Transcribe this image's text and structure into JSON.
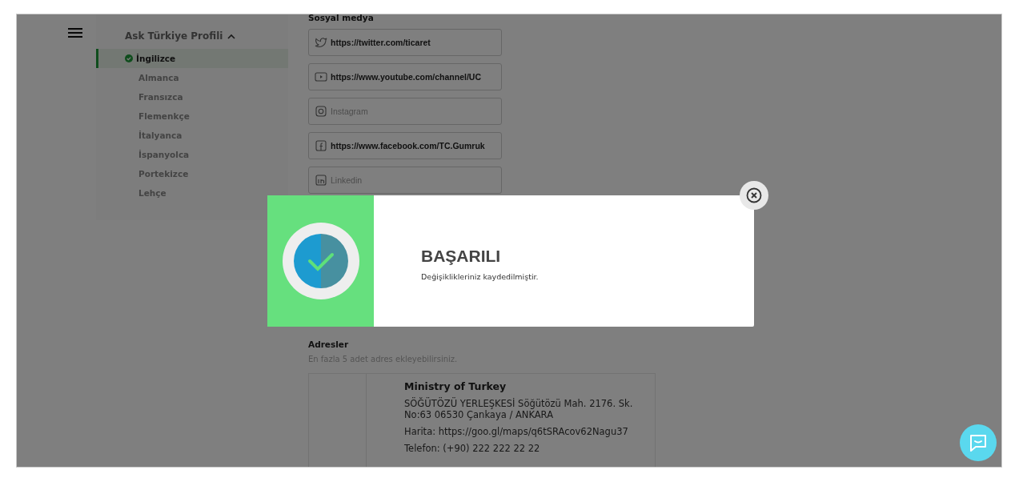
{
  "sidebar": {
    "title": "Ask Türkiye Profili",
    "expanded": true,
    "items": [
      {
        "label": "İngilizce",
        "selected": true,
        "done": true
      },
      {
        "label": "Almanca",
        "selected": false,
        "done": false
      },
      {
        "label": "Fransızca",
        "selected": false,
        "done": false
      },
      {
        "label": "Flemenkçe",
        "selected": false,
        "done": false
      },
      {
        "label": "İtalyanca",
        "selected": false,
        "done": false
      },
      {
        "label": "İspanyolca",
        "selected": false,
        "done": false
      },
      {
        "label": "Portekizce",
        "selected": false,
        "done": false
      },
      {
        "label": "Lehçe",
        "selected": false,
        "done": false
      }
    ]
  },
  "social": {
    "title": "Sosyal medya",
    "fields": [
      {
        "kind": "twitter",
        "value": "https://twitter.com/ticaret"
      },
      {
        "kind": "youtube",
        "value": "https://www.youtube.com/channel/UC"
      },
      {
        "kind": "instagram",
        "placeholder": "Instagram"
      },
      {
        "kind": "facebook",
        "value": "https://www.facebook.com/TC.Gumruk"
      },
      {
        "kind": "linkedin",
        "placeholder": "Linkedin"
      }
    ]
  },
  "addresses": {
    "title": "Adresler",
    "hint": "En fazla 5 adet adres ekleyebilirsiniz.",
    "items": [
      {
        "name": "Ministry of Turkey",
        "lines": [
          "SÖĞÜTÖZÜ YERLEŞKESİ Söğütözü Mah. 2176. Sk. No:63 06530 Çankaya / ANKARA",
          "Harita: https://goo.gl/maps/q6tSRAcov62Nagu37",
          "Telefon: (+90) 222 222 22 22"
        ]
      }
    ]
  },
  "dialog": {
    "kind": "success",
    "title": "BAŞARILI",
    "message": "Değişiklikleriniz kaydedilmiştir."
  }
}
